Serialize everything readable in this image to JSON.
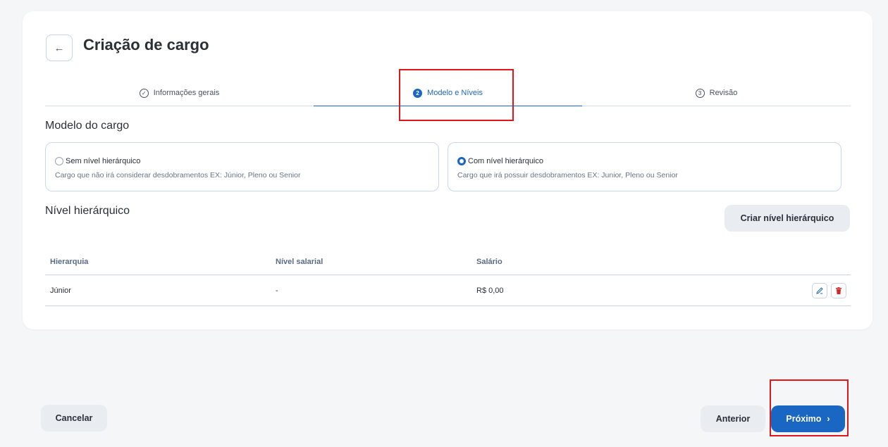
{
  "page": {
    "title": "Criação de cargo"
  },
  "stepper": {
    "steps": [
      {
        "label": "Informações gerais",
        "marker": "✓",
        "state": "done"
      },
      {
        "label": "Modelo e Níveis",
        "marker": "2",
        "state": "active"
      },
      {
        "label": "Revisão",
        "marker": "3",
        "state": "pending"
      }
    ]
  },
  "modelo": {
    "title": "Modelo do cargo",
    "options": [
      {
        "label": "Sem nível hierárquico",
        "description": "Cargo que não irá considerar desdobramentos EX: Júnior, Pleno ou Senior",
        "selected": false
      },
      {
        "label": "Com nível hierárquico",
        "description": "Cargo que irá possuir desdobramentos EX: Junior, Pleno ou Senior",
        "selected": true
      }
    ]
  },
  "nivel": {
    "title": "Nível hierárquico",
    "create_label": "Criar nível hierárquico",
    "columns": [
      "Hierarquia",
      "Nível salarial",
      "Salário"
    ],
    "rows": [
      {
        "hierarquia": "Júnior",
        "nivel_salarial": "-",
        "salario": "R$ 0,00"
      }
    ]
  },
  "footer": {
    "cancel_label": "Cancelar",
    "prev_label": "Anterior",
    "next_label": "Próximo"
  },
  "colors": {
    "accent": "#1a66c6",
    "highlight": "#e0161b",
    "delete": "#d62828"
  },
  "icons": {
    "back": "arrow-left-icon",
    "step_done": "check-circle-icon",
    "edit": "pencil-icon",
    "delete": "trash-icon",
    "next": "chevron-right-icon"
  }
}
